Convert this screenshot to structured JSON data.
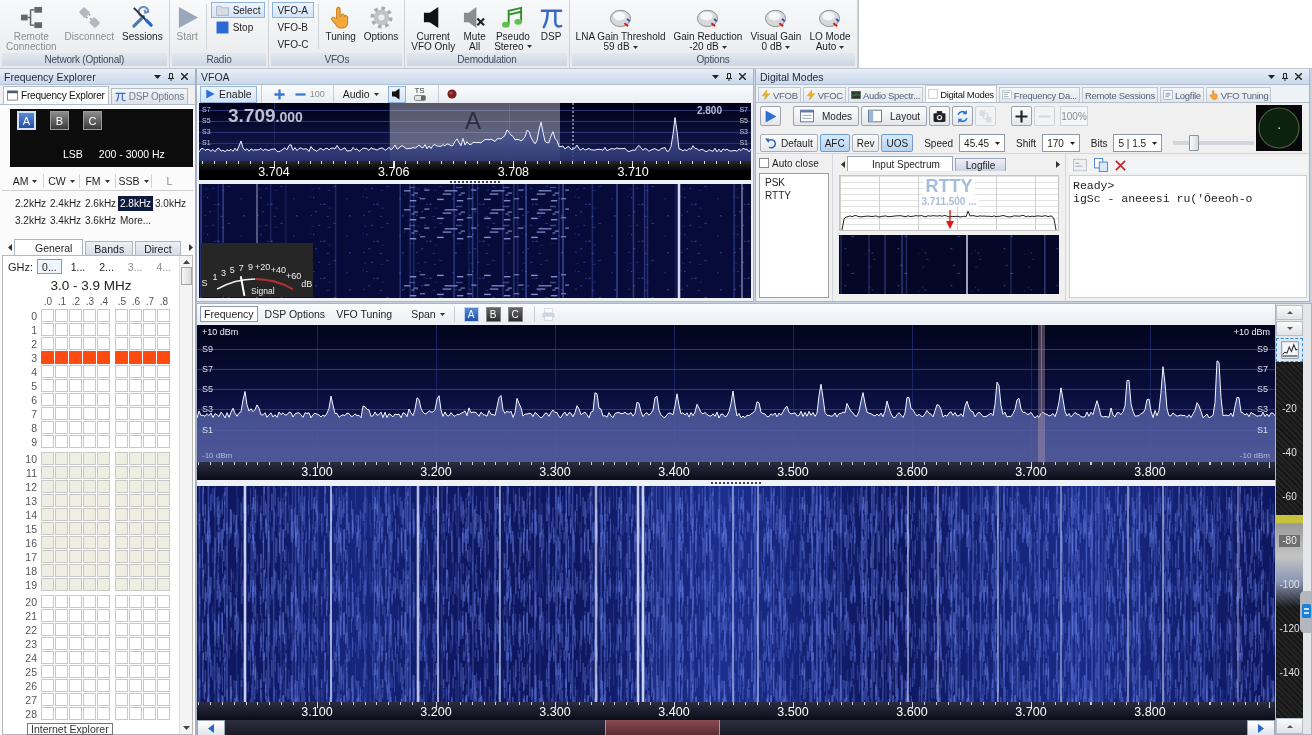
{
  "ribbon": {
    "groups": [
      {
        "title": "Network (Optional)",
        "items": [
          {
            "kind": "network",
            "label": "Remote\nConnection",
            "disabled": true,
            "menu": false
          },
          {
            "kind": "plug",
            "label": "Disconnect",
            "disabled": true,
            "menu": false
          },
          {
            "kind": "tools",
            "label": "Sessions",
            "disabled": false,
            "menu": false
          }
        ]
      },
      {
        "title": "Radio",
        "items": [
          {
            "kind": "play",
            "label": "Start",
            "disabled": true,
            "menu": false
          },
          {
            "kind": "stack",
            "items": [
              {
                "kind": "folder",
                "label": "Select",
                "selected": true
              },
              {
                "kind": "stop",
                "label": "Stop",
                "selected": false
              }
            ]
          }
        ]
      },
      {
        "title": "VFOs",
        "items": [
          {
            "kind": "stack",
            "items": [
              {
                "kind": "plain",
                "label": "VFO-A",
                "selected": true
              },
              {
                "kind": "plain",
                "label": "VFO-B",
                "selected": false
              },
              {
                "kind": "plain",
                "label": "VFO-C",
                "selected": false
              }
            ]
          },
          {
            "kind": "hand",
            "label": "Tuning",
            "disabled": false,
            "menu": false
          },
          {
            "kind": "gear",
            "label": "Options",
            "disabled": false,
            "menu": false
          }
        ]
      },
      {
        "title": "Demodulation",
        "items": [
          {
            "kind": "speaker",
            "label": "Current\nVFO Only",
            "disabled": false,
            "menu": false
          },
          {
            "kind": "mute",
            "label": "Mute\nAll",
            "disabled": false,
            "menu": false
          },
          {
            "kind": "note",
            "label": "Pseudo\nStereo",
            "disabled": false,
            "menu": true
          },
          {
            "kind": "pi",
            "label": "DSP",
            "disabled": false,
            "menu": false
          }
        ]
      },
      {
        "title": "Options",
        "items": [
          {
            "kind": "knob",
            "label": "LNA Gain Threshold",
            "value": "59 dB",
            "disabled": false,
            "menu": true
          },
          {
            "kind": "knob",
            "label": "Gain Reduction",
            "value": "-20 dB",
            "disabled": false,
            "menu": true
          },
          {
            "kind": "knob",
            "label": "Visual Gain",
            "value": "0 dB",
            "disabled": false,
            "menu": true
          },
          {
            "kind": "knob",
            "label": "LO Mode",
            "value": "Auto",
            "disabled": false,
            "menu": true
          }
        ]
      }
    ]
  },
  "frequency_explorer": {
    "title": "Frequency Explorer",
    "tabs": [
      {
        "kind": "window",
        "label": "Frequency Explorer",
        "selected": true
      },
      {
        "kind": "pi",
        "label": "DSP Options",
        "selected": false
      }
    ],
    "vfo_buttons": [
      {
        "label": "A",
        "selected": true
      },
      {
        "label": "B",
        "selected": false
      },
      {
        "label": "C",
        "selected": false
      }
    ],
    "mode": "LSB",
    "filter": "200 - 3000 Hz",
    "modes": [
      {
        "label": "AM",
        "menu": true,
        "disabled": false
      },
      {
        "label": "CW",
        "menu": true,
        "disabled": false
      },
      {
        "label": "FM",
        "menu": true,
        "disabled": false
      },
      {
        "label": "SSB",
        "menu": true,
        "disabled": false
      },
      {
        "label": "L",
        "menu": false,
        "disabled": true
      }
    ],
    "bandwidths": [
      {
        "label": "2.2kHz",
        "selected": false
      },
      {
        "label": "2.4kHz",
        "selected": false
      },
      {
        "label": "2.6kHz",
        "selected": false
      },
      {
        "label": "2.8kHz",
        "selected": true
      },
      {
        "label": "3.0kHz",
        "selected": false
      },
      {
        "label": "3.2kHz",
        "selected": false
      },
      {
        "label": "3.4kHz",
        "selected": false
      },
      {
        "label": "3.6kHz",
        "selected": false
      },
      {
        "label": "More...",
        "selected": false
      }
    ],
    "range_tabs": [
      {
        "label": "General",
        "selected": true
      },
      {
        "label": "Bands",
        "selected": false
      },
      {
        "label": "Direct",
        "selected": false
      }
    ],
    "ghz_label": "GHz:",
    "ghz": [
      {
        "label": "0...",
        "selected": true,
        "disabled": false
      },
      {
        "label": "1...",
        "selected": false,
        "disabled": false
      },
      {
        "label": "2...",
        "selected": false,
        "disabled": false
      },
      {
        "label": "3...",
        "selected": false,
        "disabled": true
      },
      {
        "label": "4...",
        "selected": false,
        "disabled": true
      }
    ],
    "range_title": "3.0 - 3.9 MHz",
    "columns": [
      ".0",
      ".1",
      ".2",
      ".3",
      ".4",
      ".5",
      ".6",
      ".7",
      ".8"
    ],
    "groups": [
      {
        "shaded": false,
        "rows": [
          {
            "label": "0",
            "selected": false
          },
          {
            "label": "1",
            "selected": false
          },
          {
            "label": "2",
            "selected": false
          },
          {
            "label": "3",
            "selected": true
          },
          {
            "label": "4",
            "selected": false
          },
          {
            "label": "5",
            "selected": false
          },
          {
            "label": "6",
            "selected": false
          },
          {
            "label": "7",
            "selected": false
          },
          {
            "label": "8",
            "selected": false
          },
          {
            "label": "9",
            "selected": false
          }
        ]
      },
      {
        "shaded": true,
        "rows": [
          {
            "label": "10",
            "selected": false
          },
          {
            "label": "11",
            "selected": false
          },
          {
            "label": "12",
            "selected": false
          },
          {
            "label": "13",
            "selected": false
          },
          {
            "label": "14",
            "selected": false
          },
          {
            "label": "15",
            "selected": false
          },
          {
            "label": "16",
            "selected": false
          },
          {
            "label": "17",
            "selected": false
          },
          {
            "label": "18",
            "selected": false
          },
          {
            "label": "19",
            "selected": false
          }
        ]
      },
      {
        "shaded": false,
        "rows": [
          {
            "label": "20",
            "selected": false
          },
          {
            "label": "21",
            "selected": false
          },
          {
            "label": "22",
            "selected": false
          },
          {
            "label": "23",
            "selected": false
          },
          {
            "label": "24",
            "selected": false
          },
          {
            "label": "25",
            "selected": false
          },
          {
            "label": "26",
            "selected": false
          },
          {
            "label": "27",
            "selected": false
          },
          {
            "label": "28",
            "selected": false
          }
        ]
      }
    ],
    "tooltip": "Internet Explorer"
  },
  "vfo_a": {
    "title": "VFOA",
    "toolbar": {
      "enable": {
        "label": "Enable",
        "selected": true
      },
      "step": {
        "value": "100",
        "disabled": true
      },
      "audio": {
        "label": "Audio"
      },
      "speaker": {
        "selected": true
      },
      "ts": {
        "label": "TS",
        "selected": false
      }
    },
    "frequency": {
      "main": "3.709",
      "fine": ".000"
    },
    "bandwidth": "2.800",
    "passband_label": "A",
    "left_scale": [
      "S7",
      "S5",
      "S3",
      "S1"
    ],
    "right_scale": [
      "S7",
      "S5",
      "S3",
      "S1"
    ],
    "scale": [
      "3.704",
      "3.706",
      "3.708",
      "3.710"
    ],
    "smeter": {
      "scale": [
        "S",
        "1",
        "3",
        "5",
        "7",
        "9",
        "+20",
        "+40",
        "+60"
      ],
      "unit": "dB",
      "label": "Signal",
      "level": 0.33
    }
  },
  "digital_modes": {
    "title": "Digital Modes",
    "tabs": [
      {
        "kind": "bolt",
        "label": "VFOB",
        "selected": false
      },
      {
        "kind": "bolt",
        "label": "VFOC",
        "selected": false
      },
      {
        "kind": "monitor",
        "label": "Audio Spectr...",
        "selected": false
      },
      {
        "kind": "page",
        "label": "Digital Modes",
        "selected": true
      },
      {
        "kind": "chart",
        "label": "Frequency Da...",
        "selected": false
      },
      {
        "kind": "none",
        "label": "Remote Sessions",
        "selected": false
      },
      {
        "kind": "log",
        "label": "Logfile",
        "selected": false
      },
      {
        "kind": "hand",
        "label": "VFO Tuning",
        "selected": false
      }
    ],
    "toolbar": [
      {
        "kind": "bplay",
        "disabled": false
      },
      {
        "kind": "modes",
        "label": "Modes",
        "disabled": false
      },
      {
        "kind": "layout",
        "label": "Layout",
        "disabled": false
      },
      {
        "kind": "camera",
        "disabled": false
      },
      {
        "kind": "refresh",
        "disabled": false
      },
      {
        "kind": "netgrey",
        "disabled": true
      },
      {
        "kind": "plus",
        "disabled": false
      },
      {
        "kind": "minus",
        "disabled": true
      }
    ],
    "zoom": {
      "value": "100%",
      "disabled": true
    },
    "toggles": [
      {
        "kind": "undo",
        "label": "Default",
        "selected": false
      },
      {
        "kind": "plain",
        "label": "AFC",
        "selected": true
      },
      {
        "kind": "plain",
        "label": "Rev",
        "selected": false
      },
      {
        "kind": "plain",
        "label": "UOS",
        "selected": true
      }
    ],
    "selects": [
      {
        "label": "Speed",
        "value": "45.45"
      },
      {
        "label": "Shift",
        "value": "170"
      },
      {
        "label": "Bits",
        "value": "5 | 1.5"
      }
    ],
    "slider": {
      "level": 0.22
    },
    "auto_close": {
      "label": "Auto close",
      "checked": false
    },
    "modes_list": [
      {
        "label": "PSK",
        "selected": false
      },
      {
        "label": "RTTY",
        "selected": false
      }
    ],
    "view_tabs": [
      {
        "label": "Input Spectrum",
        "selected": true
      },
      {
        "label": "Logfile",
        "selected": false
      }
    ],
    "spectrum": {
      "mode": "RTTY",
      "frequency": "3.711.500 ..."
    },
    "output": [
      "Ready>",
      "igSc - aneeesi ru('Õeeoh-o"
    ]
  },
  "spectrum_view": {
    "tabs": [
      {
        "label": "Frequency",
        "selected": true
      },
      {
        "label": "DSP Options",
        "selected": false
      },
      {
        "label": "VFO Tuning",
        "selected": false
      }
    ],
    "span": {
      "label": "Span"
    },
    "vfo_buttons": [
      {
        "label": "A",
        "selected": true
      },
      {
        "label": "B",
        "selected": false
      },
      {
        "label": "C",
        "selected": false
      }
    ],
    "print": {
      "disabled": true
    },
    "top_left": "+10 dBm",
    "top_right": "+10 dBm",
    "left_scale": [
      "S9",
      "S7",
      "S5",
      "S3",
      "S1"
    ],
    "right_scale": [
      "S9",
      "S7",
      "S5",
      "S3",
      "S1"
    ],
    "bottom_left": "-10 dBm",
    "bottom_right": "-10 dBm",
    "scale": [
      "3.100",
      "3.200",
      "3.300",
      "3.400",
      "3.500",
      "3.600",
      "3.700",
      "3.800"
    ],
    "waterfall_scale": [
      "3.100",
      "3.200",
      "3.300",
      "3.400",
      "3.500",
      "3.600",
      "3.700",
      "3.800"
    ],
    "level_scale": [
      "-20",
      "-40",
      "-60",
      "-80",
      "-100",
      "-120",
      "-140"
    ]
  }
}
